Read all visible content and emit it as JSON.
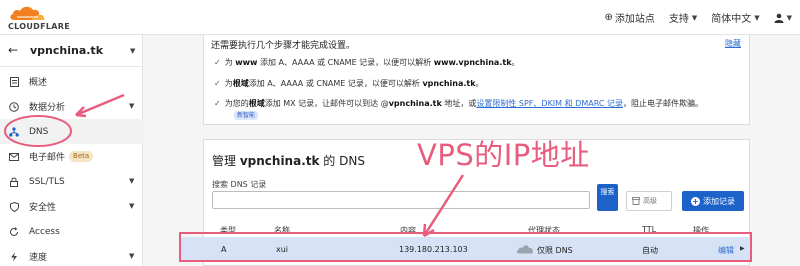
{
  "topbar": {
    "logo_text": "CLOUDFLARE",
    "add_site_label": "添加站点",
    "support_label": "支持",
    "language_label": "简体中文"
  },
  "sidebar": {
    "site_name": "vpnchina.tk",
    "items": [
      {
        "label": "概述",
        "icon": "document-icon"
      },
      {
        "label": "数据分析",
        "icon": "clock-icon"
      },
      {
        "label": "DNS",
        "icon": "network-icon"
      },
      {
        "label": "电子邮件",
        "icon": "mail-icon",
        "badge": "Beta"
      },
      {
        "label": "SSL/TLS",
        "icon": "lock-icon"
      },
      {
        "label": "安全性",
        "icon": "shield-icon"
      },
      {
        "label": "Access",
        "icon": "refresh-icon"
      },
      {
        "label": "速度",
        "icon": "lightning-icon"
      }
    ]
  },
  "setup_card": {
    "heading": "还需要执行几个步骤才能完成设置。",
    "hide_label": "隐藏",
    "row1": {
      "pre": "为 ",
      "bold": "www",
      "mid": " 添加 A、AAAA 或 CNAME 记录，以便可以解析 ",
      "bold2": "www.vpnchina.tk",
      "post": "。"
    },
    "row2": {
      "pre": "为",
      "bold": "根域",
      "mid": "添加 A、AAAA 或 CNAME 记录，以便可以解析 ",
      "bold2": "vpnchina.tk",
      "post": "。"
    },
    "row3": {
      "pre": "为您的",
      "bold": "根域",
      "mid": "添加 MX 记录，让邮件可以到达 @",
      "bold2": "vpnchina.tk",
      "mid2": " 地址，或",
      "link": "设置限制性 SPF、DKIM 和 DMARC 记录",
      "post": "，阻止电子邮件欺骗。"
    },
    "new_badge": "新智能"
  },
  "dns_card": {
    "title_pre": "管理 ",
    "title_domain": "vpnchina.tk",
    "title_post": " 的 DNS",
    "search_label": "搜索 DNS 记录",
    "search_placeholder": "",
    "search_button": "搜索",
    "advanced_button": "高级",
    "add_record_button": "添加记录",
    "columns": [
      "类型",
      "名称",
      "内容",
      "代理状态",
      "TTL",
      "操作"
    ],
    "records": [
      {
        "type": "A",
        "name": "xui",
        "content": "139.180.213.103",
        "proxy": "仅限 DNS",
        "ttl": "自动",
        "action": "编辑"
      }
    ]
  },
  "annotations": {
    "vps_label": "VPS的IP地址",
    "color": "#e85c7e"
  },
  "colors": {
    "accent_blue": "#1c62c9",
    "cloudflare_orange": "#f38020",
    "row_highlight": "#d6e3f6"
  }
}
